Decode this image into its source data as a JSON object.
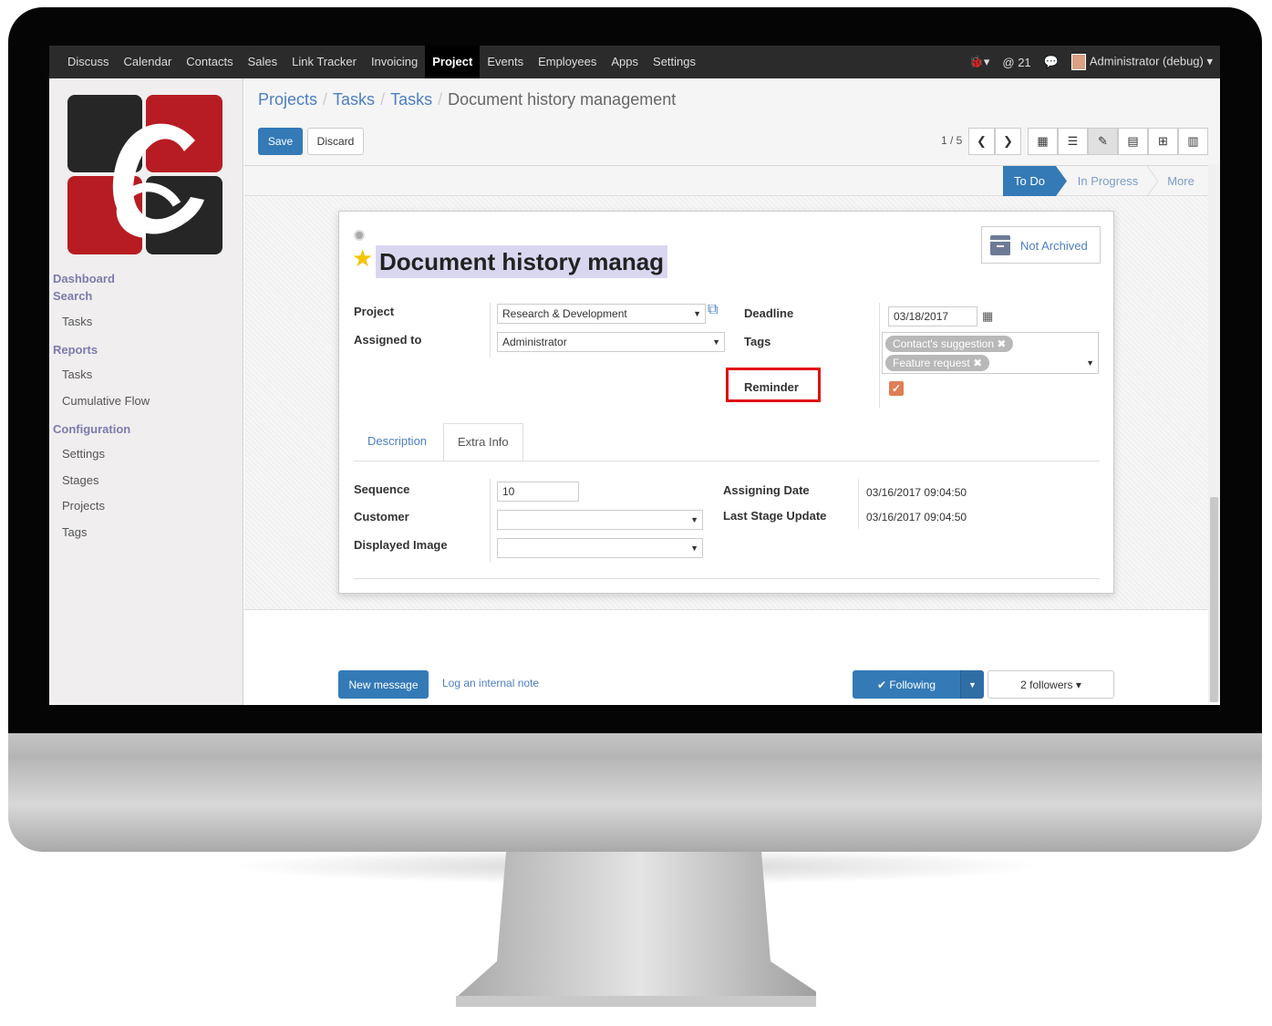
{
  "topbar": {
    "menu": [
      "Discuss",
      "Calendar",
      "Contacts",
      "Sales",
      "Link Tracker",
      "Invoicing",
      "Project",
      "Events",
      "Employees",
      "Apps",
      "Settings"
    ],
    "active_menu": "Project",
    "bug_icon": "bug-icon",
    "mention_count": "@ 21",
    "chat_icon": "chat-bubbles-icon",
    "user": "Administrator (debug)"
  },
  "sidebar": {
    "dashboard": "Dashboard",
    "search": "Search",
    "search_items": [
      "Tasks"
    ],
    "reports": "Reports",
    "report_items": [
      "Tasks",
      "Cumulative Flow"
    ],
    "configuration": "Configuration",
    "config_items": [
      "Settings",
      "Stages",
      "Projects",
      "Tags"
    ]
  },
  "breadcrumb": {
    "items": [
      "Projects",
      "Tasks",
      "Tasks"
    ],
    "current": "Document history management",
    "separator": "/"
  },
  "actions": {
    "save": "Save",
    "discard": "Discard"
  },
  "pager": {
    "text": "1 / 5"
  },
  "stages": {
    "current": "To Do",
    "next": "In Progress",
    "more": "More"
  },
  "form": {
    "title": "Document history manag",
    "archive_label": "Not Archived",
    "project_label": "Project",
    "project_value": "Research & Development",
    "assigned_label": "Assigned to",
    "assigned_value": "Administrator",
    "deadline_label": "Deadline",
    "deadline_value": "03/18/2017",
    "tags_label": "Tags",
    "tags": [
      "Contact's suggestion",
      "Feature request"
    ],
    "reminder_label": "Reminder",
    "reminder_checked": true
  },
  "tabs": {
    "description": "Description",
    "extra_info": "Extra Info"
  },
  "extra": {
    "sequence_label": "Sequence",
    "sequence_value": "10",
    "customer_label": "Customer",
    "customer_value": "",
    "displayed_image_label": "Displayed Image",
    "displayed_image_value": "",
    "assigning_date_label": "Assigning Date",
    "assigning_date_value": "03/16/2017 09:04:50",
    "last_stage_label": "Last Stage Update",
    "last_stage_value": "03/16/2017 09:04:50"
  },
  "chatter": {
    "new_message": "New message",
    "log_note": "Log an internal note",
    "following": "✔ Following",
    "followers": "2 followers ▾"
  },
  "colors": {
    "primary": "#337ab7",
    "sidebar_heading": "#7c7bad",
    "highlight_box": "#e01010",
    "checkbox": "#e07e55",
    "logo_red": "#b71c22",
    "logo_dark": "#262626"
  }
}
